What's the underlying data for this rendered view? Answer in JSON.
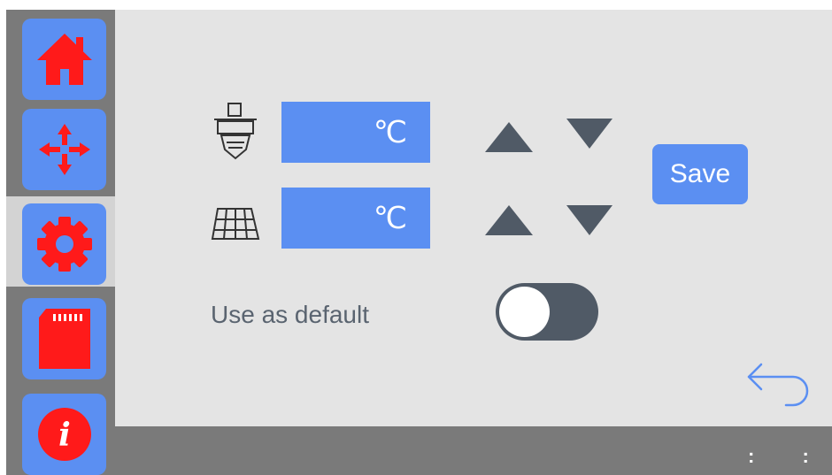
{
  "sidebar": {
    "items": [
      {
        "name": "home",
        "icon": "home-icon"
      },
      {
        "name": "move",
        "icon": "move-arrows-icon"
      },
      {
        "name": "settings",
        "icon": "gear-icon",
        "selected": true
      },
      {
        "name": "sd-card",
        "icon": "sd-card-icon"
      },
      {
        "name": "info",
        "icon": "info-icon"
      }
    ]
  },
  "temperature": {
    "nozzle_unit": "℃",
    "bed_unit": "℃",
    "nozzle_icon": "nozzle-icon",
    "bed_icon": "heated-bed-icon"
  },
  "actions": {
    "save_label": "Save"
  },
  "default_option": {
    "label": "Use as default",
    "enabled": false
  },
  "icons": {
    "back": "back-arrow-icon",
    "more": "more-dots-icon"
  },
  "colors": {
    "accent": "#5b8ff2",
    "icon_red": "#ff1a1a",
    "dark": "#505a66"
  }
}
